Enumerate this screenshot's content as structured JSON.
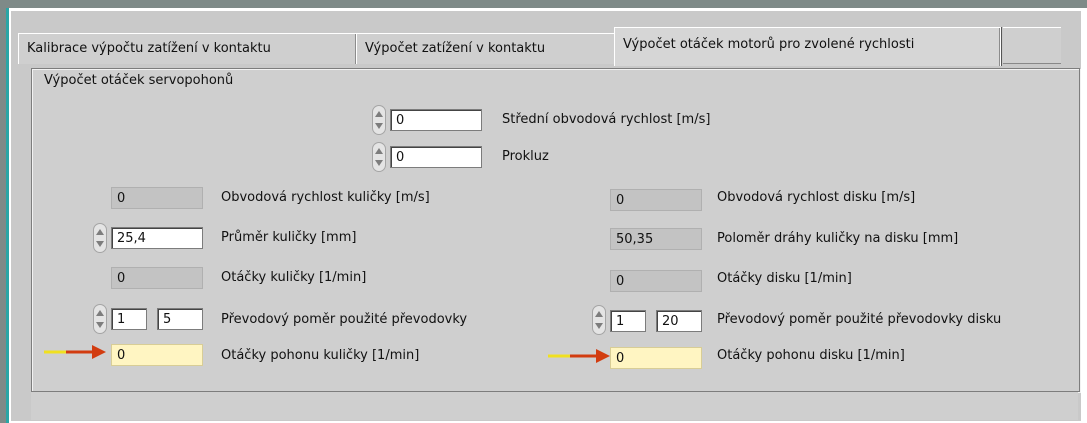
{
  "tabs": [
    {
      "label": "Kalibrace výpočtu zatížení v kontaktu",
      "active": false
    },
    {
      "label": "Výpočet zatížení v kontaktu",
      "active": false
    },
    {
      "label": "Výpočet otáček motorů pro zvolené rychlosti",
      "active": true
    }
  ],
  "group_title": "Výpočet otáček servopohonů",
  "top": {
    "mean_speed": {
      "label": "Střední obvodová rychlost [m/s]",
      "value": "0"
    },
    "slip": {
      "label": "Prokluz",
      "value": "0"
    }
  },
  "ball": {
    "surface_speed": {
      "label": "Obvodová rychlost kuličky [m/s]",
      "value": "0"
    },
    "diameter": {
      "label": "Průměr kuličky [mm]",
      "value": "25,4"
    },
    "rpm": {
      "label": "Otáčky kuličky [1/min]",
      "value": "0"
    },
    "gear_ratio": {
      "label": "Převodový poměr použité převodovky",
      "value_a": "1",
      "value_b": "5"
    },
    "drive_rpm": {
      "label": "Otáčky pohonu kuličky [1/min]",
      "value": "0"
    }
  },
  "disk": {
    "surface_speed": {
      "label": "Obvodová rychlost disku [m/s]",
      "value": "0"
    },
    "track_radius": {
      "label": "Poloměr dráhy kuličky na disku [mm]",
      "value": "50,35"
    },
    "rpm": {
      "label": "Otáčky disku [1/min]",
      "value": "0"
    },
    "gear_ratio": {
      "label": "Převodový poměr použité převodovky disku",
      "value_a": "1",
      "value_b": "20"
    },
    "drive_rpm": {
      "label": "Otáčky pohonu disku [1/min]",
      "value": "0"
    }
  },
  "colors": {
    "panel": "#c9c9c9",
    "indicator": "#c3c3c3",
    "output_indicator": "#fff5c2",
    "arrow_tail": "#f0e020",
    "arrow_head": "#d23c10",
    "frame_teal": "#2aa6a6"
  }
}
